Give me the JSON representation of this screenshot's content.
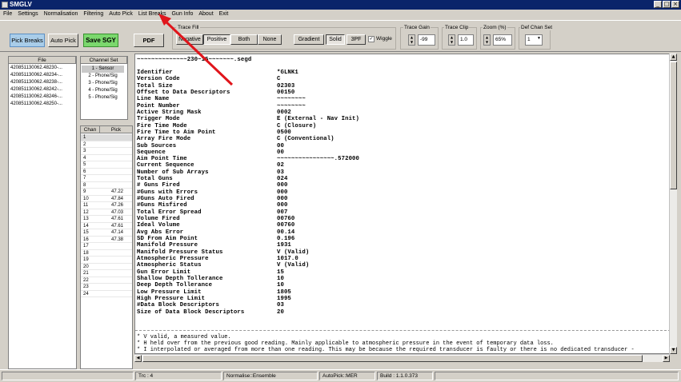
{
  "window": {
    "title": "SMGLV"
  },
  "menu": [
    "File",
    "Settings",
    "Normalisation",
    "Filtering",
    "Auto Pick",
    "List Breaks",
    "Gun Info",
    "About",
    "Exit"
  ],
  "toolbar": {
    "pick_breaks": "Pick Breaks",
    "auto_pick": "Auto Pick",
    "save_sgy": "Save SGY",
    "pdf": "PDF",
    "trace_fill_label": "Trace Fill",
    "fill_negative": "Negative",
    "fill_positive": "Positive",
    "fill_both": "Both",
    "fill_none": "None",
    "gradient": "Gradient",
    "solid": "Solid",
    "3pf": "3PF",
    "wiggle": "Wiggle",
    "trace_gain_label": "Trace Gain",
    "trace_gain_value": "-99",
    "trace_clip_label": "Trace Clip",
    "trace_clip_value": "1.0",
    "zoom_label": "Zoom (%)",
    "zoom_value": "65%",
    "def_chan_label": "Def Chan Set",
    "def_chan_value": "1"
  },
  "files": {
    "header": "File",
    "items": [
      "420851130062.48230-...",
      "420851130062.48234-...",
      "420851130062.48238-...",
      "420851130062.48242-...",
      "420851130062.48246-...",
      "420851130062.48250-..."
    ]
  },
  "channel_set": {
    "header": "Channel Set",
    "items": [
      "1 - Sensor",
      "2 - Phone/Sig",
      "3 - Phone/Sig",
      "4 - Phone/Sig",
      "5 - Phone/Sig"
    ]
  },
  "picks": {
    "col_chan": "Chan",
    "col_pick": "Pick",
    "rows": [
      {
        "chan": "1",
        "pick": ""
      },
      {
        "chan": "2",
        "pick": ""
      },
      {
        "chan": "3",
        "pick": ""
      },
      {
        "chan": "4",
        "pick": ""
      },
      {
        "chan": "5",
        "pick": ""
      },
      {
        "chan": "6",
        "pick": ""
      },
      {
        "chan": "7",
        "pick": ""
      },
      {
        "chan": "8",
        "pick": ""
      },
      {
        "chan": "9",
        "pick": "47.22"
      },
      {
        "chan": "10",
        "pick": "47.84"
      },
      {
        "chan": "11",
        "pick": "47.26"
      },
      {
        "chan": "12",
        "pick": "47.03"
      },
      {
        "chan": "13",
        "pick": "47.61"
      },
      {
        "chan": "14",
        "pick": "47.61"
      },
      {
        "chan": "15",
        "pick": "47.14"
      },
      {
        "chan": "16",
        "pick": "47.38"
      },
      {
        "chan": "17",
        "pick": ""
      },
      {
        "chan": "18",
        "pick": ""
      },
      {
        "chan": "19",
        "pick": ""
      },
      {
        "chan": "20",
        "pick": ""
      },
      {
        "chan": "21",
        "pick": ""
      },
      {
        "chan": "22",
        "pick": ""
      },
      {
        "chan": "23",
        "pick": ""
      },
      {
        "chan": "24",
        "pick": ""
      }
    ]
  },
  "main": {
    "filename": "~~~~~~~~~~~~~~230~15~~~~~~~.segd",
    "fields": [
      {
        "k": "Identifier",
        "v": "*GLNK1"
      },
      {
        "k": "Version Code",
        "v": "C"
      },
      {
        "k": "Total Size",
        "v": "02303"
      },
      {
        "k": "Offset to Data Descriptors",
        "v": "00150"
      },
      {
        "k": "Line Name",
        "v": "~~~~~~~~"
      },
      {
        "k": "Point Number",
        "v": "~~~~~~~~"
      },
      {
        "k": "Active String Mask",
        "v": "0002"
      },
      {
        "k": "Trigger Mode",
        "v": "E (External - Nav Init)"
      },
      {
        "k": "Fire Time Mode",
        "v": "C (Closure)"
      },
      {
        "k": "Fire Time to Aim Point",
        "v": "0500"
      },
      {
        "k": "Array Fire Mode",
        "v": "C (Conventional)"
      },
      {
        "k": "Sub Sources",
        "v": "00"
      },
      {
        "k": "Sequence",
        "v": "00"
      },
      {
        "k": "Aim Point Time",
        "v": "~~~~~~~~~~~~~~~~.572000"
      },
      {
        "k": "Current Sequence",
        "v": "02"
      },
      {
        "k": "Number of Sub Arrays",
        "v": "03"
      },
      {
        "k": "Total Guns",
        "v": "024"
      },
      {
        "k": "# Guns Fired",
        "v": "000"
      },
      {
        "k": "#Guns with Errors",
        "v": "000"
      },
      {
        "k": "#Guns Auto Fired",
        "v": "000"
      },
      {
        "k": "#Guns Misfired",
        "v": "000"
      },
      {
        "k": "Total Error Spread",
        "v": "007"
      },
      {
        "k": "Volume Fired",
        "v": "00760"
      },
      {
        "k": "Ideal Volume",
        "v": "00760"
      },
      {
        "k": "Avg Abs Error",
        "v": "00.14"
      },
      {
        "k": "SD From Aim Point",
        "v": "0.196"
      },
      {
        "k": "Manifold Pressure",
        "v": "1931"
      },
      {
        "k": "Manifold Pressure Status",
        "v": "V (Valid)"
      },
      {
        "k": "Atmospheric Pressure",
        "v": "1017.0"
      },
      {
        "k": "Atmospheric Status",
        "v": "V (Valid)"
      },
      {
        "k": "Gun Error Limit",
        "v": "15"
      },
      {
        "k": "Shallow Depth Tollerance",
        "v": "10"
      },
      {
        "k": "Deep Depth Tollerance",
        "v": "10"
      },
      {
        "k": "Low Pressure Limit",
        "v": "1805"
      },
      {
        "k": "High Pressure Limit",
        "v": "1995"
      },
      {
        "k": "#Data Block Descriptors",
        "v": "03"
      },
      {
        "k": "Size of Data Block Descriptors",
        "v": "20"
      }
    ],
    "notes": [
      "*   V  valid, a measured value.",
      "*   H  held over from the previous good reading. Mainly applicable to atmospheric pressure in the event of temporary data loss.",
      "*   I  interpolated or averaged from more than one reading. This may be because the required transducer is faulty or there is no dedicated transducer -"
    ]
  },
  "status": {
    "trc": "Trc : 4",
    "normalise": "Normalise::Ensemble",
    "autopick": "AutoPick::MER",
    "build": "Build : 1.1.0.373"
  },
  "colors": {
    "titlebar": "#0a246a",
    "save_sgy": "#7bd86d",
    "pick_breaks": "#a9cde9",
    "arrow": "#e0151b"
  }
}
